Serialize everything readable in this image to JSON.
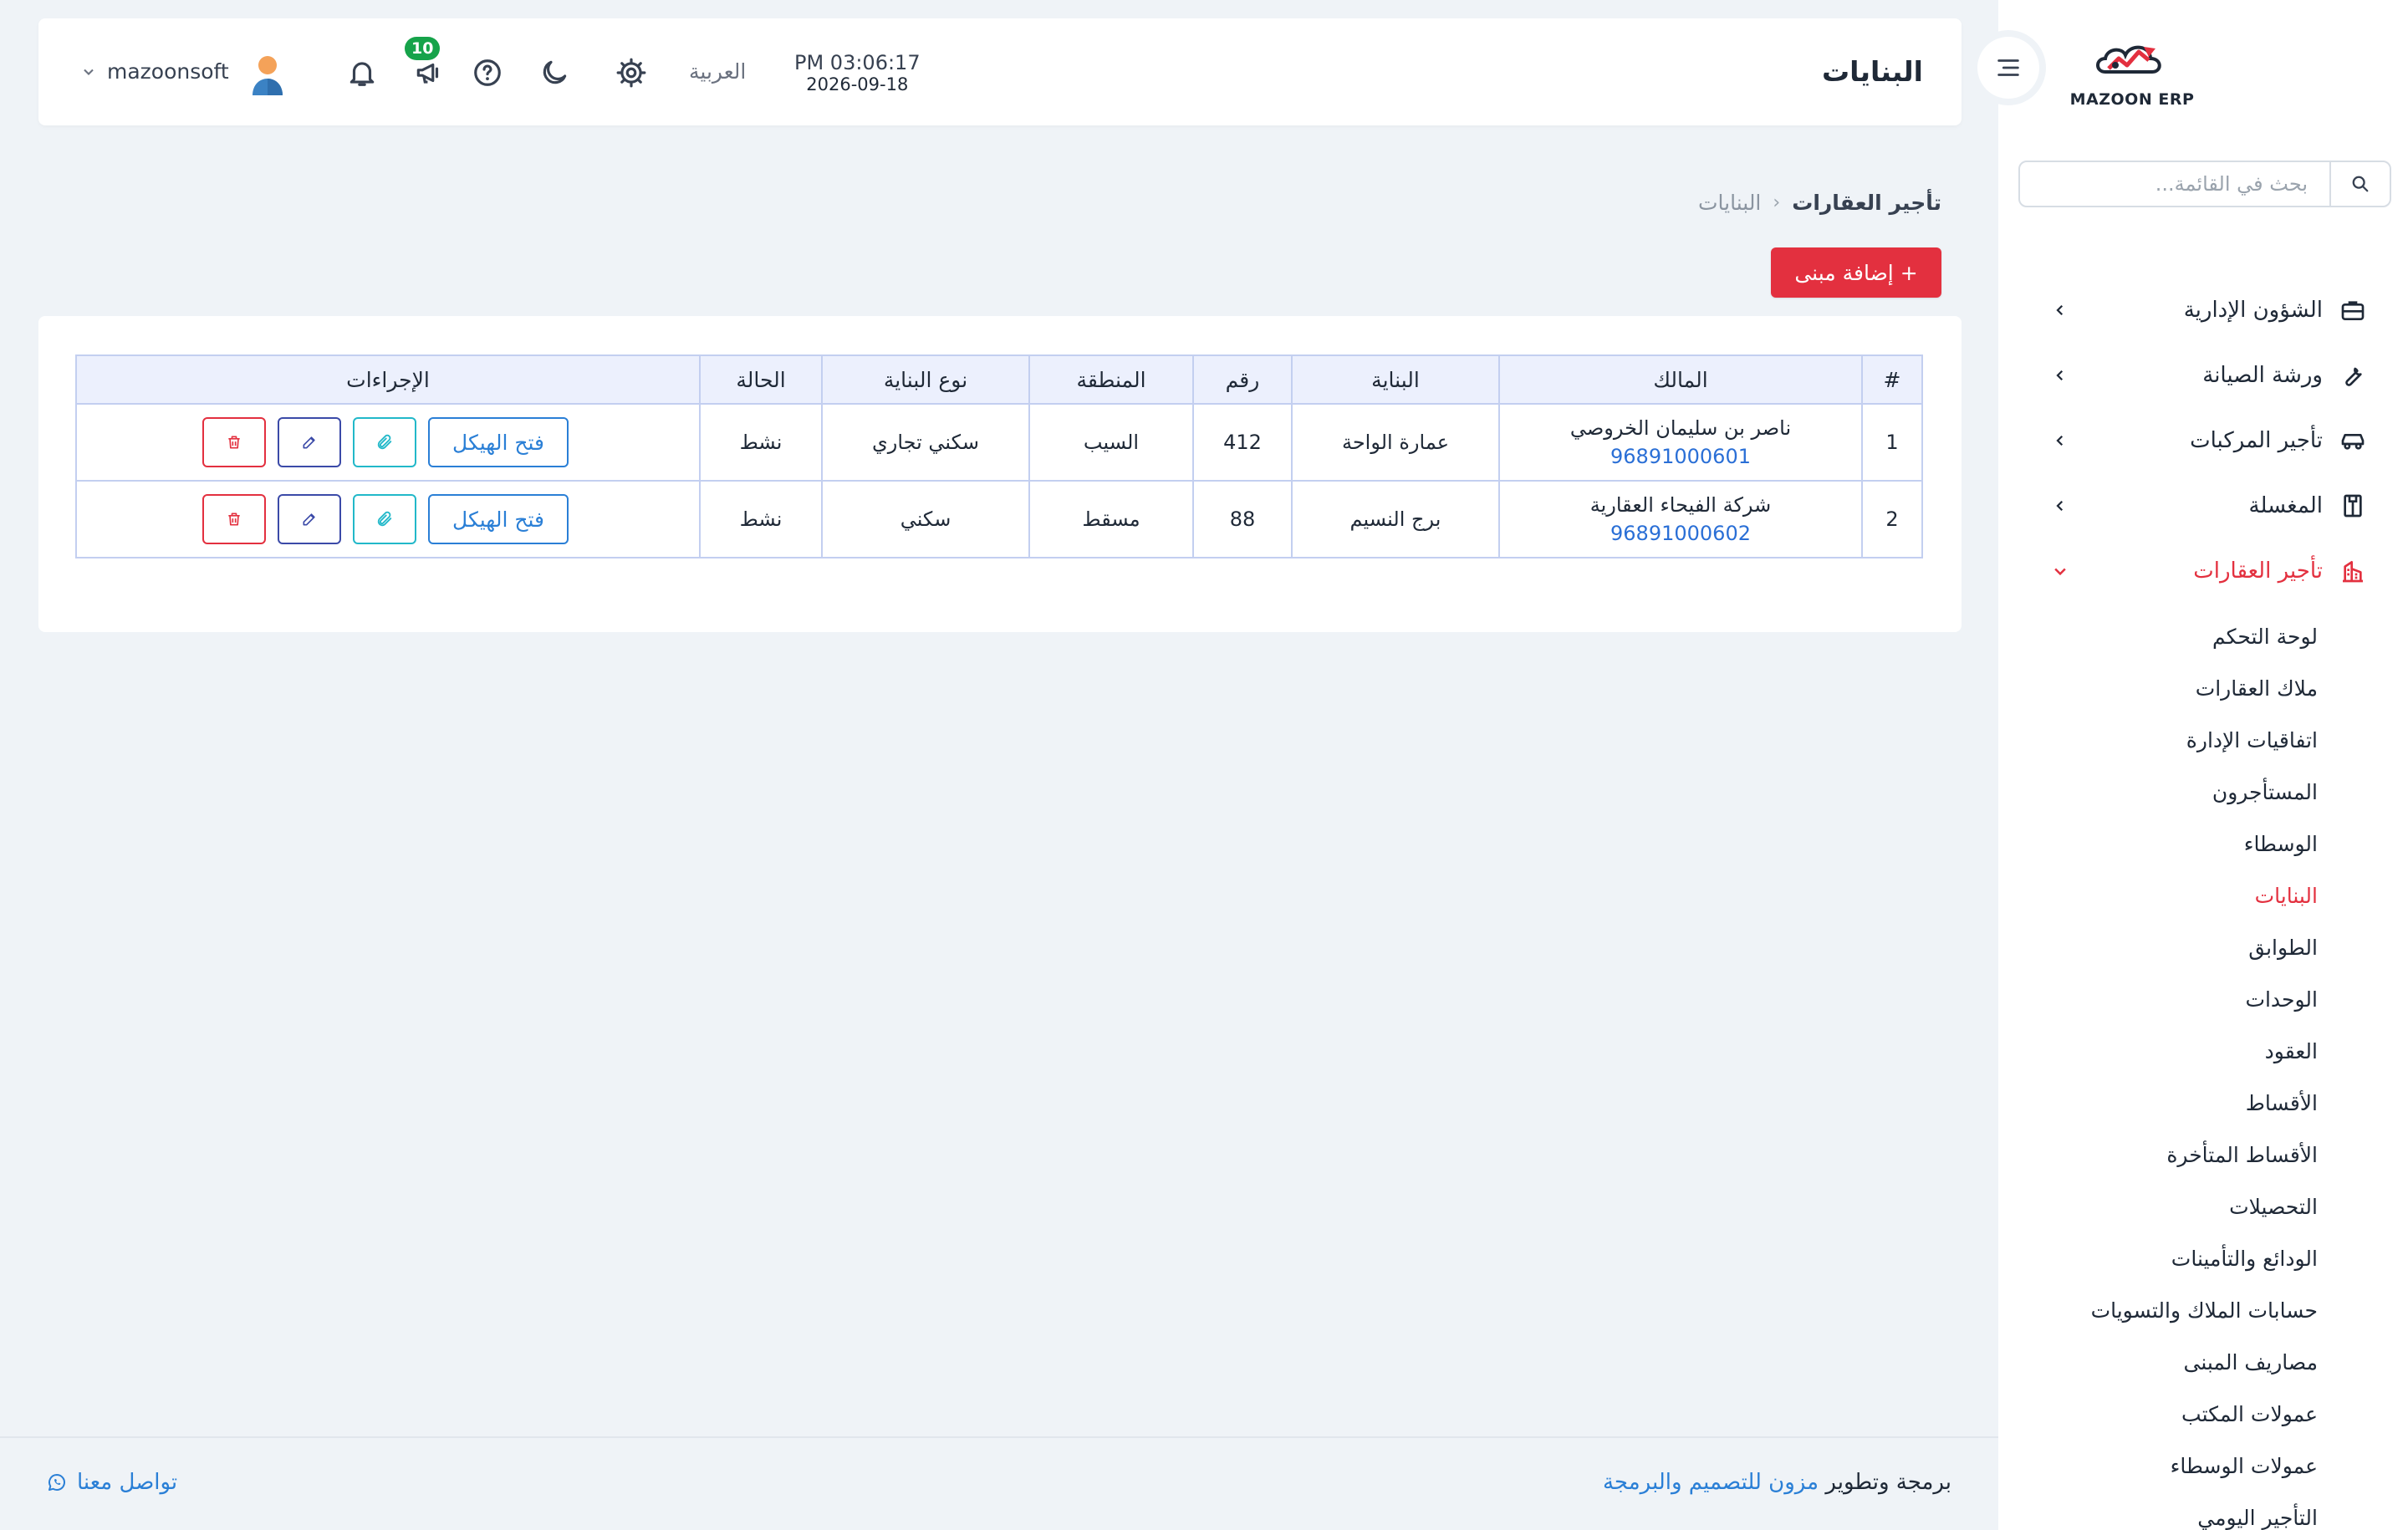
{
  "sidebar": {
    "logo_text": "MAZOON ERP",
    "logo_tag": "ERP|ERP",
    "search_placeholder": "بحث في القائمة...",
    "menu": [
      {
        "label": "الشؤون الإدارية",
        "icon": "briefcase-icon"
      },
      {
        "label": "ورشة الصيانة",
        "icon": "wrench-icon"
      },
      {
        "label": "تأجير المركبات",
        "icon": "car-icon"
      },
      {
        "label": "المغسلة",
        "icon": "laundry-icon"
      },
      {
        "label": "تأجير العقارات",
        "icon": "building-icon"
      }
    ],
    "submenu": [
      "لوحة التحكم",
      "ملاك العقارات",
      "اتفاقيات الإدارة",
      "المستأجرون",
      "الوسطاء",
      "البنايات",
      "الطوابق",
      "الوحدات",
      "العقود",
      "الأقساط",
      "الأقساط المتأخرة",
      "التحصيلات",
      "الودائع والتأمينات",
      "حسابات الملاك والتسويات",
      "مصاريف المبنى",
      "عمولات المكتب",
      "عمولات الوسطاء",
      "التأجير اليومي"
    ],
    "active_submenu": "البنايات"
  },
  "header": {
    "title": "البنايات",
    "time": "PM 03:06:17",
    "date": "2026-09-18",
    "language": "العربية",
    "notification_badge": "10",
    "username": "mazoonsoft"
  },
  "breadcrumb": {
    "parent": "تأجير العقارات",
    "separator": "‹",
    "current": "البنايات"
  },
  "add_button": "+ إضافة مبنى",
  "table": {
    "headers": [
      "#",
      "المالك",
      "البناية",
      "رقم",
      "المنطقة",
      "نوع البناية",
      "الحالة",
      "الإجراءات"
    ],
    "rows": [
      {
        "num": "1",
        "owner": "ناصر بن سليمان الخروصي",
        "phone": "96891000601",
        "building": "عمارة الواحة",
        "number": "412",
        "area": "السيب",
        "type": "سكني تجاري",
        "status": "نشط",
        "open_label": "فتح الهيكل"
      },
      {
        "num": "2",
        "owner": "شركة الفيحاء العقارية",
        "phone": "96891000602",
        "building": "برج النسيم",
        "number": "88",
        "area": "مسقط",
        "type": "سكني",
        "status": "نشط",
        "open_label": "فتح الهيكل"
      }
    ]
  },
  "footer": {
    "credit_prefix": "برمجة وتطوير",
    "company": "مزون للتصميم والبرمجة",
    "contact": "تواصل معنا"
  },
  "colors": {
    "accent": "#e3303f",
    "link": "#2a7fd6",
    "badge": "#16a34a",
    "background": "#eff3f7"
  }
}
